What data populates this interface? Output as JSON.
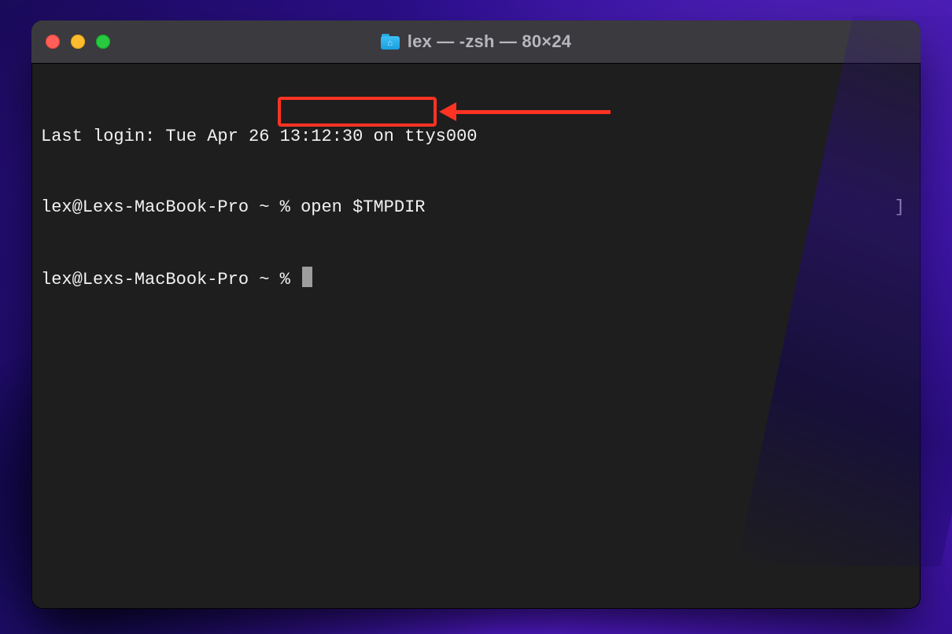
{
  "window": {
    "title": "lex — -zsh — 80×24"
  },
  "terminal": {
    "last_login_line": "Last login: Tue Apr 26 13:12:30 on ttys000",
    "prompt1_prefix": "lex@Lexs-MacBook-Pro ~ % ",
    "prompt1_cmd": "open $TMPDIR",
    "prompt2": "lex@Lexs-MacBook-Pro ~ % "
  },
  "annotation": {
    "purpose": "highlight-command"
  }
}
